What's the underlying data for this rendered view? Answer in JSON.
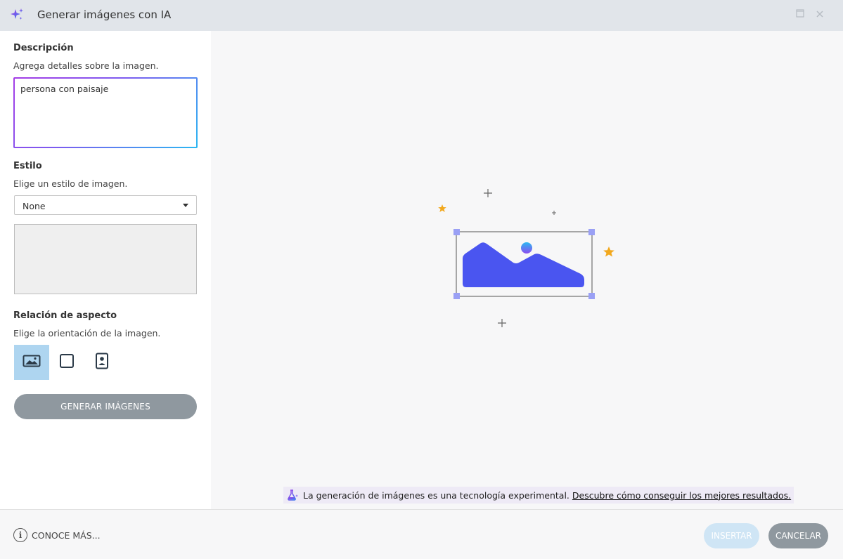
{
  "window": {
    "title": "Generar imágenes con IA",
    "icon": "sparkle-icon",
    "accent_purple": "#7b5cf0",
    "accent_blue": "#2bb8f2"
  },
  "sidebar": {
    "description": {
      "heading": "Descripción",
      "subtitle": "Agrega detalles sobre la imagen.",
      "value": "persona con paisaje"
    },
    "style": {
      "heading": "Estilo",
      "subtitle": "Elige un estilo de imagen.",
      "selected": "None"
    },
    "aspect": {
      "heading": "Relación de aspecto",
      "subtitle": "Elige la orientación de la imagen.",
      "options": [
        "landscape-icon",
        "square-icon",
        "portrait-icon"
      ],
      "selected": "landscape-icon"
    },
    "generate_label": "GENERAR IMÁGENES"
  },
  "main": {
    "illustration": "image-placeholder-icon",
    "notice_text": "La generación de imágenes es una tecnología experimental.",
    "notice_link": "Descubre cómo conseguir los mejores resultados."
  },
  "footer": {
    "learn_more": "CONOCE MÁS...",
    "insert_label": "INSERTAR",
    "cancel_label": "CANCELAR"
  }
}
